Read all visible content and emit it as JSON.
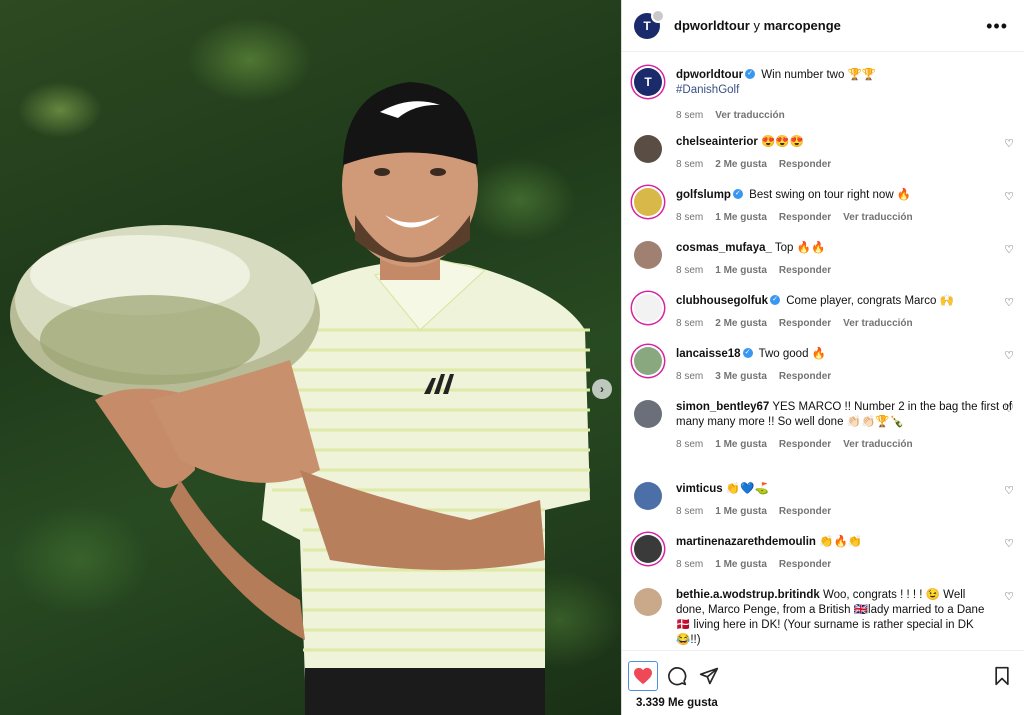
{
  "post": {
    "header_user1": "dpworldtour",
    "header_connector": " y ",
    "header_user2": "marcopenge",
    "more_label": "•••",
    "caption": {
      "user": "dpworldtour",
      "text": "Win number two 🏆🏆",
      "hashtag": "#DanishGolf",
      "time": "8 sem",
      "translate": "Ver traducción"
    },
    "likes": "3.339 Me gusta"
  },
  "comments": [
    {
      "user": "chelseainterior",
      "verified": false,
      "text": "😍😍😍",
      "time": "8 sem",
      "likes": "2 Me gusta",
      "reply": "Responder",
      "translate": ""
    },
    {
      "user": "golfslump",
      "verified": true,
      "text": "Best swing on tour right now 🔥",
      "time": "8 sem",
      "likes": "1 Me gusta",
      "reply": "Responder",
      "translate": "Ver traducción"
    },
    {
      "user": "cosmas_mufaya_",
      "verified": false,
      "text": "Top 🔥🔥",
      "time": "8 sem",
      "likes": "1 Me gusta",
      "reply": "Responder",
      "translate": ""
    },
    {
      "user": "clubhousegolfuk",
      "verified": true,
      "text": "Come player, congrats Marco 🙌",
      "time": "8 sem",
      "likes": "2 Me gusta",
      "reply": "Responder",
      "translate": "Ver traducción"
    },
    {
      "user": "lancaisse18",
      "verified": true,
      "text": "Two good 🔥",
      "time": "8 sem",
      "likes": "3 Me gusta",
      "reply": "Responder",
      "translate": ""
    },
    {
      "user": "simon_bentley67",
      "verified": false,
      "text": "YES MARCO !! Number 2 in the bag the first of many many more !! So well done 👏🏻👏🏻🏆🍾",
      "time": "8 sem",
      "likes": "1 Me gusta",
      "reply": "Responder",
      "translate": "Ver traducción"
    },
    {
      "user": "vimticus",
      "verified": false,
      "text": "👏💙⛳",
      "time": "8 sem",
      "likes": "1 Me gusta",
      "reply": "Responder",
      "translate": ""
    },
    {
      "user": "martinenazarethdemoulin",
      "verified": false,
      "text": "👏🔥👏",
      "time": "8 sem",
      "likes": "1 Me gusta",
      "reply": "Responder",
      "translate": ""
    },
    {
      "user": "bethie.a.wodstrup.britindk",
      "verified": false,
      "text": "Woo, congrats ! ! ! ! 😉 Well done, Marco Penge, from a British 🇬🇧lady married to a Dane 🇩🇰 living here in DK! (Your surname is rather special in DK 😂!!)",
      "time": "",
      "likes": "",
      "reply": "",
      "translate": ""
    }
  ],
  "icons": {
    "like": "heart-icon",
    "comment": "comment-icon",
    "share": "share-icon",
    "save": "bookmark-icon",
    "next": "chevron-right-icon"
  },
  "colors": {
    "like_red": "#ed4956",
    "verified_blue": "#3897f0",
    "hashtag": "#385185",
    "muted": "#737373"
  }
}
